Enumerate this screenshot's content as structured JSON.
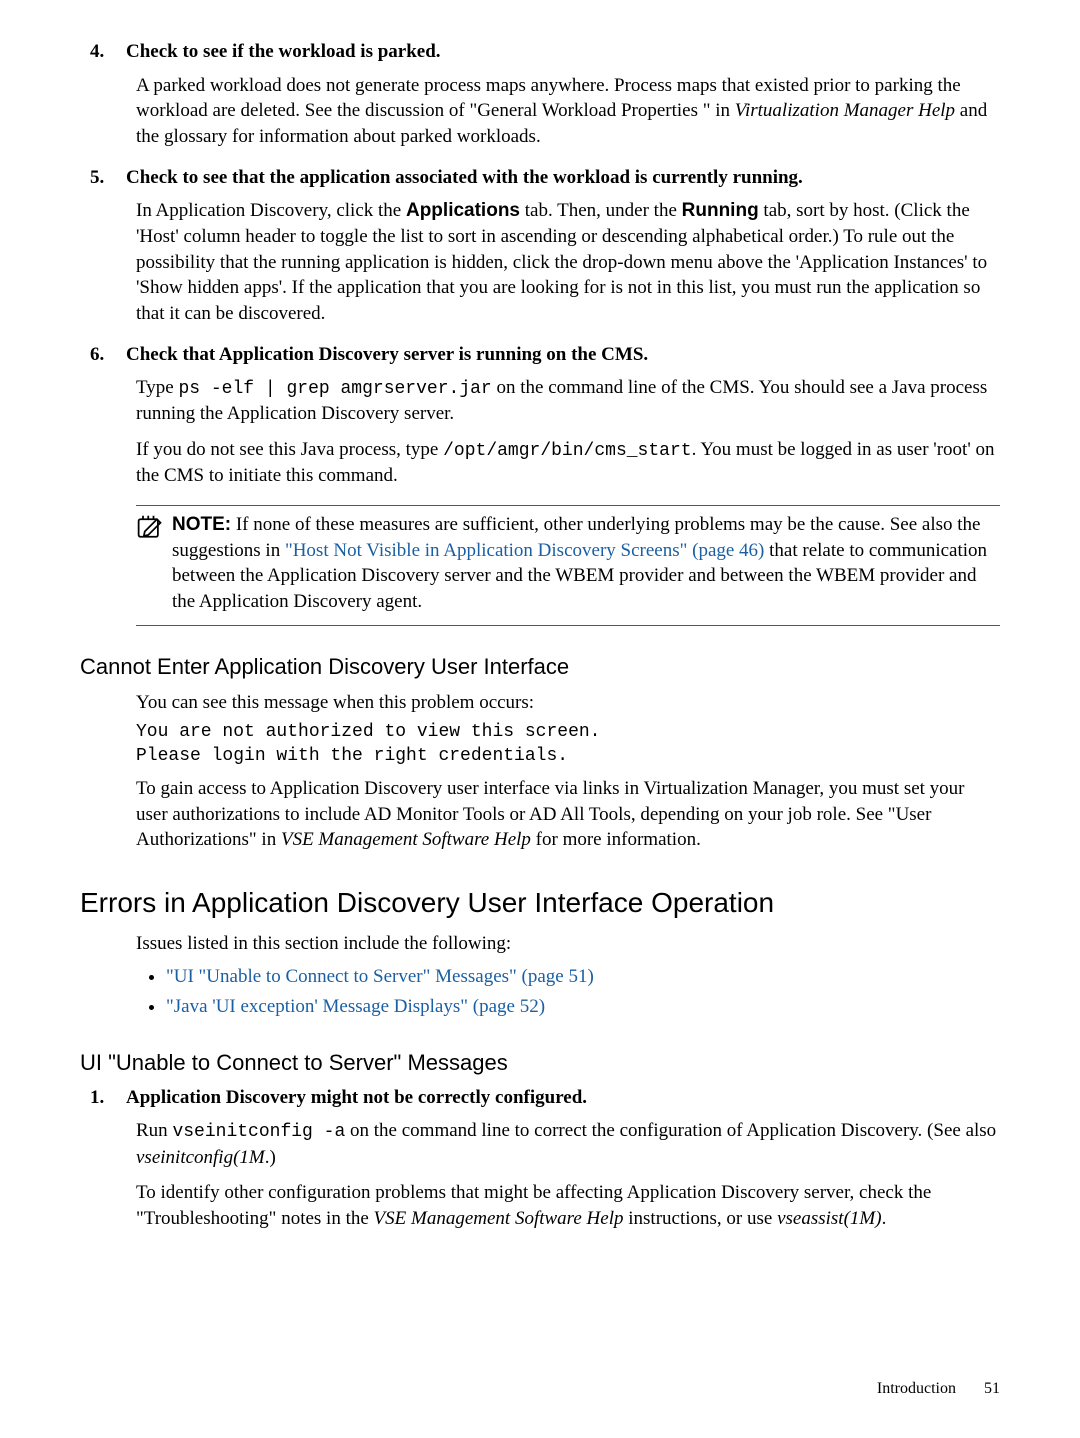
{
  "steps": {
    "s4": {
      "num": "4.",
      "title": "Check to see if the workload is parked.",
      "p1a": "A parked workload does not generate process maps anywhere. Process maps that existed prior to parking the workload are deleted. See the discussion of \"General Workload Properties \" in ",
      "p1b": "Virtualization Manager Help",
      "p1c": " and the glossary for information about parked workloads."
    },
    "s5": {
      "num": "5.",
      "title": "Check to see that the application associated with the workload is currently running.",
      "p1a": "In Application Discovery, click the ",
      "p1b": "Applications",
      "p1c": " tab. Then, under the ",
      "p1d": "Running",
      "p1e": " tab, sort by host. (Click the 'Host' column header to toggle the list to sort in ascending or descending alphabetical order.) To rule out the possibility that the running application is hidden, click the drop-down menu above the 'Application Instances' to 'Show hidden apps'. If the application that you are looking for is not in this list, you must run the application so that it can be discovered."
    },
    "s6": {
      "num": "6.",
      "title": "Check that Application Discovery server is running on the CMS.",
      "p1a": "Type ",
      "p1b": "ps -elf | grep amgrserver.jar",
      "p1c": " on the command line of the CMS. You should see a Java process running the Application Discovery server.",
      "p2a": "If you do not see this Java process, type ",
      "p2b": "/opt/amgr/bin/cms_start",
      "p2c": ". You must be logged in as user 'root' on the CMS to initiate this command."
    }
  },
  "note": {
    "label": "NOTE:",
    "t1": "If none of these measures are sufficient, other underlying problems may be the cause. See also the suggestions in ",
    "link": "\"Host Not Visible in Application Discovery Screens\" (page 46)",
    "t2": " that relate to communication between the Application Discovery server and the WBEM provider and between the WBEM provider and the Application Discovery agent."
  },
  "section_cannot": {
    "heading": "Cannot Enter Application Discovery User Interface",
    "intro": "You can see this message when this problem occurs:",
    "code": "You are not authorized to view this screen.\nPlease login with the right credentials.",
    "p1a": "To gain access to Application Discovery user interface via links in Virtualization Manager, you must set your user authorizations to include AD Monitor Tools or AD All Tools, depending on your job role. See \"User Authorizations\" in ",
    "p1b": "VSE Management Software Help",
    "p1c": " for more information."
  },
  "section_errors": {
    "heading": "Errors in Application Discovery User Interface Operation",
    "intro": "Issues listed in this section include the following:",
    "bullets": {
      "b1": "\"UI \"Unable to Connect to Server\" Messages\" (page 51)",
      "b2": "\"Java 'UI exception' Message Displays\" (page 52)"
    }
  },
  "section_ui": {
    "heading": "UI \"Unable to Connect to Server\" Messages",
    "s1": {
      "num": "1.",
      "title": "Application Discovery might not be correctly configured.",
      "p1a": "Run ",
      "p1b": "vseinitconfig -a",
      "p1c": " on the command line to correct the configuration of Application Discovery. (See also ",
      "p1d": "vseinitconfig(1M",
      "p1e": ".)",
      "p2a": "To identify other configuration problems that might be affecting Application Discovery server, check the \"Troubleshooting\" notes in the ",
      "p2b": "VSE Management Software Help",
      "p2c": " instructions, or use ",
      "p2d": "vseassist(1M)",
      "p2e": "."
    }
  },
  "footer": {
    "section": "Introduction",
    "page": "51"
  }
}
